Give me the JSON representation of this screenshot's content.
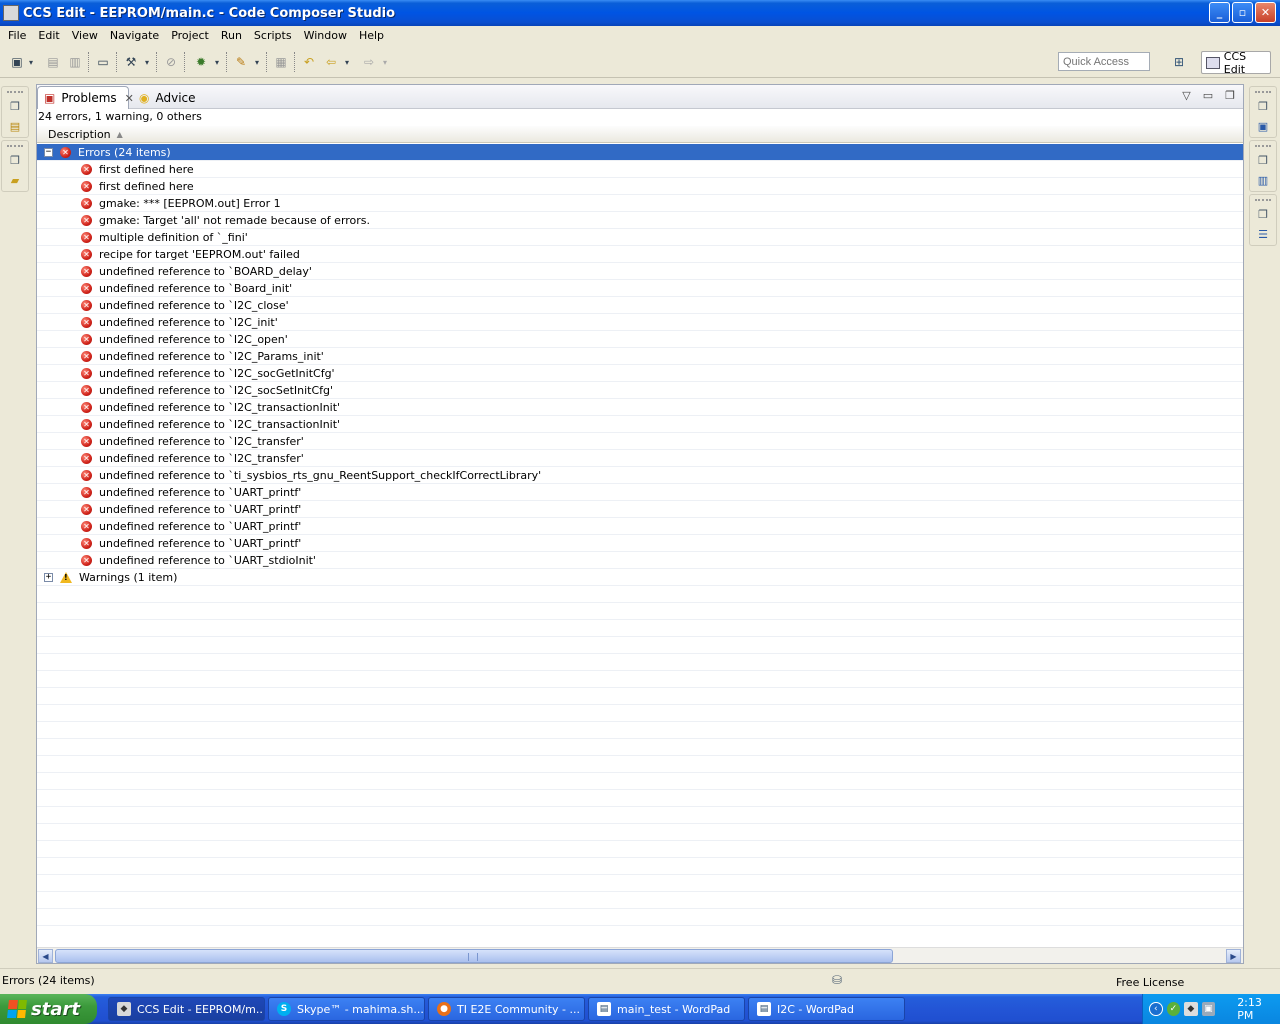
{
  "window": {
    "title": "CCS Edit - EEPROM/main.c - Code Composer Studio",
    "minimize": "_",
    "maximize": "▫",
    "close": "✕"
  },
  "menubar": {
    "items": [
      "File",
      "Edit",
      "View",
      "Navigate",
      "Project",
      "Run",
      "Scripts",
      "Window",
      "Help"
    ]
  },
  "toolbar": {
    "quick_access_placeholder": "Quick Access",
    "perspective_label": "CCS Edit"
  },
  "problems_view": {
    "tabs": [
      {
        "label": "Problems",
        "active": true
      },
      {
        "label": "Advice",
        "active": false
      }
    ],
    "summary": "24 errors, 1 warning, 0 others",
    "column_header": "Description",
    "errors_group": {
      "label": "Errors (24 items)",
      "expanded": true
    },
    "errors": [
      "first defined here",
      "first defined here",
      "gmake: *** [EEPROM.out] Error 1",
      "gmake: Target 'all' not remade because of errors.",
      "multiple definition of `_fini'",
      "recipe for target 'EEPROM.out' failed",
      "undefined reference to `BOARD_delay'",
      "undefined reference to `Board_init'",
      "undefined reference to `I2C_close'",
      "undefined reference to `I2C_init'",
      "undefined reference to `I2C_open'",
      "undefined reference to `I2C_Params_init'",
      "undefined reference to `I2C_socGetInitCfg'",
      "undefined reference to `I2C_socSetInitCfg'",
      "undefined reference to `I2C_transactionInit'",
      "undefined reference to `I2C_transactionInit'",
      "undefined reference to `I2C_transfer'",
      "undefined reference to `I2C_transfer'",
      "undefined reference to `ti_sysbios_rts_gnu_ReentSupport_checkIfCorrectLibrary'",
      "undefined reference to `UART_printf'",
      "undefined reference to `UART_printf'",
      "undefined reference to `UART_printf'",
      "undefined reference to `UART_printf'",
      "undefined reference to `UART_stdioInit'"
    ],
    "warnings_group": {
      "label": "Warnings (1 item)",
      "expanded": false
    }
  },
  "statusbar": {
    "text": "Errors (24 items)",
    "license": "Free License"
  },
  "taskbar": {
    "start_label": "start",
    "tasks": [
      {
        "label": "CCS Edit - EEPROM/m...",
        "active": true
      },
      {
        "label": "Skype™ - mahima.sh...",
        "active": false
      },
      {
        "label": "TI E2E Community - ...",
        "active": false
      },
      {
        "label": "main_test - WordPad",
        "active": false
      },
      {
        "label": "I2C - WordPad",
        "active": false
      }
    ],
    "clock": "2:13 PM"
  },
  "colors": {
    "selection": "#316ac5",
    "titlebar": "#0054e3",
    "error_icon": "#d0231a",
    "warning_icon": "#f0b820"
  }
}
